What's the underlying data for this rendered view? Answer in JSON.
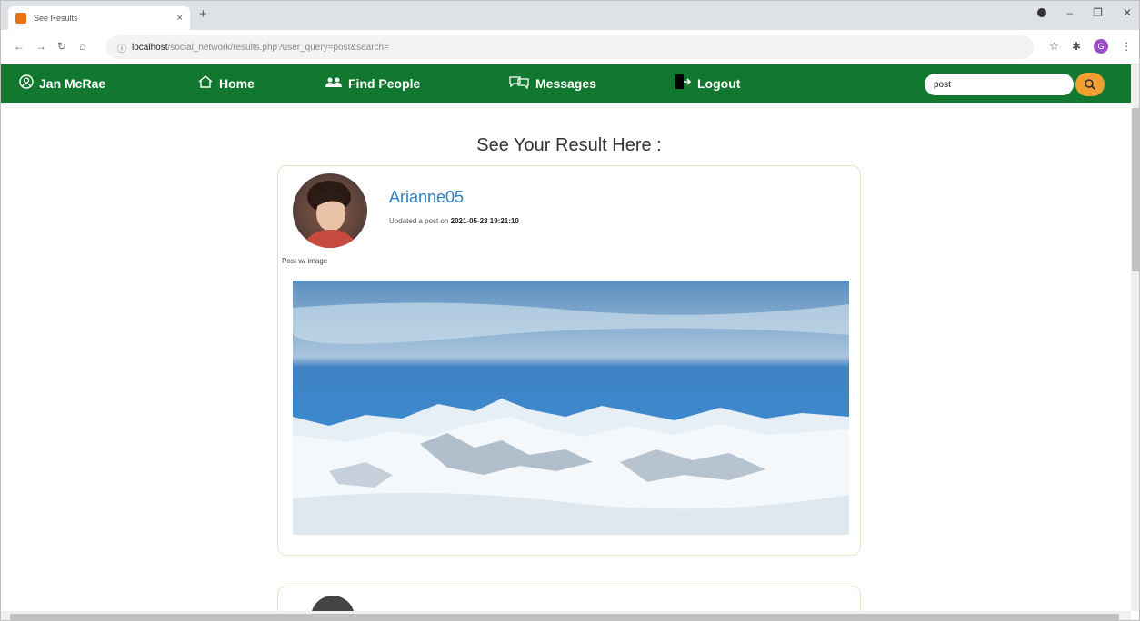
{
  "browser": {
    "tab_title": "See Results",
    "url_host": "localhost",
    "url_path": "/social_network/results.php?user_query=post&search=",
    "profile_initial": "G"
  },
  "sitenav": {
    "user": "Jan McRae",
    "home": "Home",
    "find_people": "Find People",
    "messages": "Messages",
    "logout": "Logout",
    "search_value": "post",
    "color": "#12782f",
    "search_button_color": "#f0a030"
  },
  "page": {
    "heading": "See Your Result Here :"
  },
  "posts": [
    {
      "username": "Arianne05",
      "meta_prefix": "Updated a post on",
      "date": "2021-05-23 19:21:10",
      "text": "Post w/ image"
    }
  ]
}
